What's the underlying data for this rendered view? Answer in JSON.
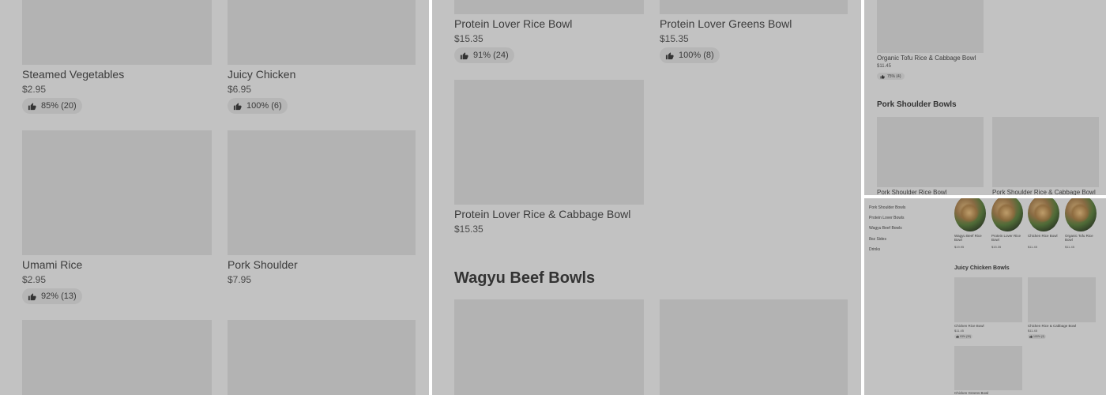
{
  "panel_a": {
    "items": [
      {
        "name": "Steamed Vegetables",
        "price": "$2.95",
        "rating": "85% (20)"
      },
      {
        "name": "Juicy Chicken",
        "price": "$6.95",
        "rating": "100% (6)"
      },
      {
        "name": "Umami Rice",
        "price": "$2.95",
        "rating": "92% (13)"
      },
      {
        "name": "Pork Shoulder",
        "price": "$7.95",
        "rating": ""
      }
    ]
  },
  "panel_b": {
    "items": [
      {
        "name": "Protein Lover Rice Bowl",
        "price": "$15.35",
        "rating": "91% (24)"
      },
      {
        "name": "Protein Lover Greens Bowl",
        "price": "$15.35",
        "rating": "100% (8)"
      },
      {
        "name": "Protein Lover Rice & Cabbage Bowl",
        "price": "$15.35",
        "rating": ""
      }
    ],
    "section_title": "Wagyu Beef Bowls"
  },
  "panel_c": {
    "top_item": {
      "name": "Organic Tofu Rice & Cabbage Bowl",
      "price": "$11.45",
      "rating": "75% (4)"
    },
    "section_title": "Pork Shoulder Bowls",
    "items": [
      {
        "name": "Pork Shoulder Rice Bowl"
      },
      {
        "name": "Pork Shoulder Rice & Cabbage Bowl"
      }
    ]
  },
  "panel_d": {
    "nav": [
      "Pork Shoulder Bowls",
      "Protein Lover Bowls",
      "Wagyu Beef Bowls",
      "8oz Sides",
      "Drinks"
    ],
    "featured": [
      {
        "name": "Wagyu Beef Rice Bowl",
        "price": "$19.95"
      },
      {
        "name": "Protein Lover Rice Bowl",
        "price": "$15.35"
      },
      {
        "name": "Chicken Rice Bowl",
        "price": "$11.45"
      },
      {
        "name": "Organic Tofu Rice Bowl",
        "price": "$11.45"
      }
    ],
    "section_title": "Juicy Chicken Bowls",
    "items": [
      {
        "name": "Chicken Rice Bowl",
        "price": "$11.45",
        "rating": "93% (30)"
      },
      {
        "name": "Chicken Rice & Cabbage Bowl",
        "price": "$11.45",
        "rating": "100% (2)"
      },
      {
        "name": "Chicken Greens Bowl",
        "price": ""
      }
    ]
  },
  "colors": {
    "overlay": "#c2c2c2",
    "image_placeholder": "#b3b3b3",
    "badge": "#b6b6b6",
    "divider": "#ffffff"
  },
  "icons": {
    "rating": "thumbs-up-icon"
  }
}
